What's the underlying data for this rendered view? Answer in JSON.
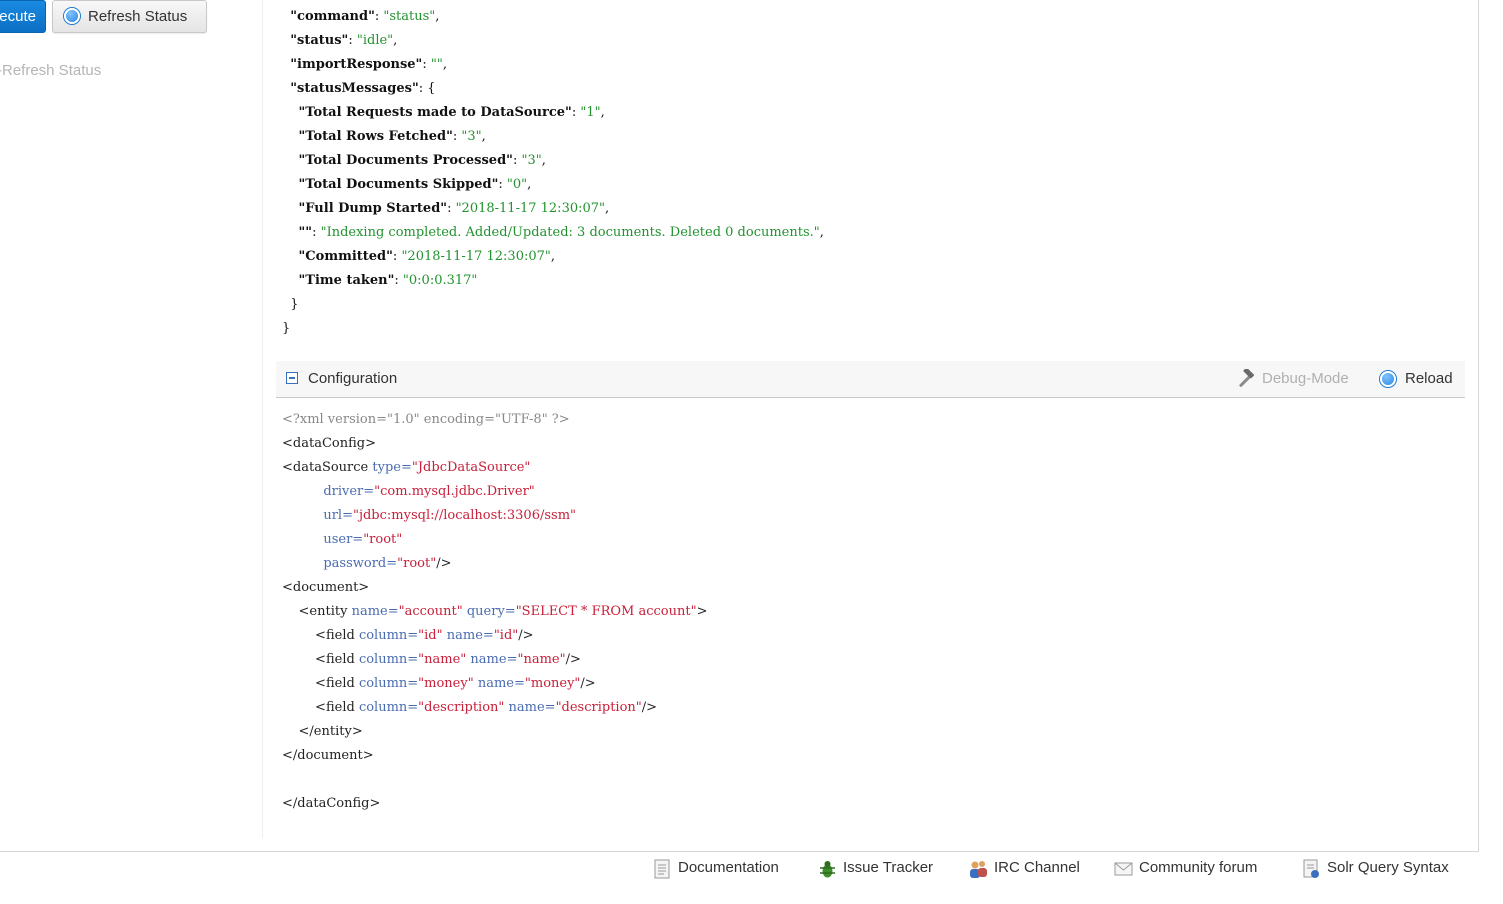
{
  "toolbar": {
    "execute_label": "ecute",
    "refresh_label": "Refresh Status",
    "auto_refresh_label": "-Refresh Status"
  },
  "status_json": {
    "lines": [
      [
        {
          "t": "  ",
          "c": "p"
        },
        {
          "t": "\"command\"",
          "c": "k"
        },
        {
          "t": ": ",
          "c": "p"
        },
        {
          "t": "\"status\"",
          "c": "s"
        },
        {
          "t": ",",
          "c": "p"
        }
      ],
      [
        {
          "t": "  ",
          "c": "p"
        },
        {
          "t": "\"status\"",
          "c": "k"
        },
        {
          "t": ": ",
          "c": "p"
        },
        {
          "t": "\"idle\"",
          "c": "s"
        },
        {
          "t": ",",
          "c": "p"
        }
      ],
      [
        {
          "t": "  ",
          "c": "p"
        },
        {
          "t": "\"importResponse\"",
          "c": "k"
        },
        {
          "t": ": ",
          "c": "p"
        },
        {
          "t": "\"\"",
          "c": "s"
        },
        {
          "t": ",",
          "c": "p"
        }
      ],
      [
        {
          "t": "  ",
          "c": "p"
        },
        {
          "t": "\"statusMessages\"",
          "c": "k"
        },
        {
          "t": ": {",
          "c": "p"
        }
      ],
      [
        {
          "t": "    ",
          "c": "p"
        },
        {
          "t": "\"Total Requests made to DataSource\"",
          "c": "k"
        },
        {
          "t": ": ",
          "c": "p"
        },
        {
          "t": "\"1\"",
          "c": "s"
        },
        {
          "t": ",",
          "c": "p"
        }
      ],
      [
        {
          "t": "    ",
          "c": "p"
        },
        {
          "t": "\"Total Rows Fetched\"",
          "c": "k"
        },
        {
          "t": ": ",
          "c": "p"
        },
        {
          "t": "\"3\"",
          "c": "s"
        },
        {
          "t": ",",
          "c": "p"
        }
      ],
      [
        {
          "t": "    ",
          "c": "p"
        },
        {
          "t": "\"Total Documents Processed\"",
          "c": "k"
        },
        {
          "t": ": ",
          "c": "p"
        },
        {
          "t": "\"3\"",
          "c": "s"
        },
        {
          "t": ",",
          "c": "p"
        }
      ],
      [
        {
          "t": "    ",
          "c": "p"
        },
        {
          "t": "\"Total Documents Skipped\"",
          "c": "k"
        },
        {
          "t": ": ",
          "c": "p"
        },
        {
          "t": "\"0\"",
          "c": "s"
        },
        {
          "t": ",",
          "c": "p"
        }
      ],
      [
        {
          "t": "    ",
          "c": "p"
        },
        {
          "t": "\"Full Dump Started\"",
          "c": "k"
        },
        {
          "t": ": ",
          "c": "p"
        },
        {
          "t": "\"2018-11-17 12:30:07\"",
          "c": "s"
        },
        {
          "t": ",",
          "c": "p"
        }
      ],
      [
        {
          "t": "    ",
          "c": "p"
        },
        {
          "t": "\"\"",
          "c": "k"
        },
        {
          "t": ": ",
          "c": "p"
        },
        {
          "t": "\"Indexing completed. Added/Updated: 3 documents. Deleted 0 documents.\"",
          "c": "s"
        },
        {
          "t": ",",
          "c": "p"
        }
      ],
      [
        {
          "t": "    ",
          "c": "p"
        },
        {
          "t": "\"Committed\"",
          "c": "k"
        },
        {
          "t": ": ",
          "c": "p"
        },
        {
          "t": "\"2018-11-17 12:30:07\"",
          "c": "s"
        },
        {
          "t": ",",
          "c": "p"
        }
      ],
      [
        {
          "t": "    ",
          "c": "p"
        },
        {
          "t": "\"Time taken\"",
          "c": "k"
        },
        {
          "t": ": ",
          "c": "p"
        },
        {
          "t": "\"0:0:0.317\"",
          "c": "s"
        }
      ],
      [
        {
          "t": "  }",
          "c": "p"
        }
      ],
      [
        {
          "t": "}",
          "c": "p"
        }
      ]
    ]
  },
  "config": {
    "title": "Configuration",
    "debug_label": "Debug-Mode",
    "reload_label": "Reload",
    "lines": [
      [
        {
          "t": "<?xml version=\"1.0\" encoding=\"UTF-8\" ?>",
          "c": "decl"
        }
      ],
      [
        {
          "t": "<dataConfig>",
          "c": "tag"
        }
      ],
      [
        {
          "t": "<dataSource ",
          "c": "tag"
        },
        {
          "t": "type=",
          "c": "attr"
        },
        {
          "t": "\"JdbcDataSource\"",
          "c": "val"
        }
      ],
      [
        {
          "t": "          ",
          "c": "p"
        },
        {
          "t": "driver=",
          "c": "attr"
        },
        {
          "t": "\"com.mysql.jdbc.Driver\"",
          "c": "val"
        }
      ],
      [
        {
          "t": "          ",
          "c": "p"
        },
        {
          "t": "url=",
          "c": "attr"
        },
        {
          "t": "\"jdbc:mysql://localhost:3306/ssm\"",
          "c": "val"
        }
      ],
      [
        {
          "t": "          ",
          "c": "p"
        },
        {
          "t": "user=",
          "c": "attr"
        },
        {
          "t": "\"root\"",
          "c": "val"
        }
      ],
      [
        {
          "t": "          ",
          "c": "p"
        },
        {
          "t": "password=",
          "c": "attr"
        },
        {
          "t": "\"root\"",
          "c": "val"
        },
        {
          "t": "/>",
          "c": "tag"
        }
      ],
      [
        {
          "t": "<document>",
          "c": "tag"
        }
      ],
      [
        {
          "t": "    <entity ",
          "c": "tag"
        },
        {
          "t": "name=",
          "c": "attr"
        },
        {
          "t": "\"account\"",
          "c": "val"
        },
        {
          "t": " ",
          "c": "p"
        },
        {
          "t": "query=",
          "c": "attr"
        },
        {
          "t": "\"SELECT * FROM account\"",
          "c": "val"
        },
        {
          "t": ">",
          "c": "tag"
        }
      ],
      [
        {
          "t": "        <field ",
          "c": "tag"
        },
        {
          "t": "column=",
          "c": "attr"
        },
        {
          "t": "\"id\"",
          "c": "val"
        },
        {
          "t": " ",
          "c": "p"
        },
        {
          "t": "name=",
          "c": "attr"
        },
        {
          "t": "\"id\"",
          "c": "val"
        },
        {
          "t": "/>",
          "c": "tag"
        }
      ],
      [
        {
          "t": "        <field ",
          "c": "tag"
        },
        {
          "t": "column=",
          "c": "attr"
        },
        {
          "t": "\"name\"",
          "c": "val"
        },
        {
          "t": " ",
          "c": "p"
        },
        {
          "t": "name=",
          "c": "attr"
        },
        {
          "t": "\"name\"",
          "c": "val"
        },
        {
          "t": "/>",
          "c": "tag"
        }
      ],
      [
        {
          "t": "        <field ",
          "c": "tag"
        },
        {
          "t": "column=",
          "c": "attr"
        },
        {
          "t": "\"money\"",
          "c": "val"
        },
        {
          "t": " ",
          "c": "p"
        },
        {
          "t": "name=",
          "c": "attr"
        },
        {
          "t": "\"money\"",
          "c": "val"
        },
        {
          "t": "/>",
          "c": "tag"
        }
      ],
      [
        {
          "t": "        <field ",
          "c": "tag"
        },
        {
          "t": "column=",
          "c": "attr"
        },
        {
          "t": "\"description\"",
          "c": "val"
        },
        {
          "t": " ",
          "c": "p"
        },
        {
          "t": "name=",
          "c": "attr"
        },
        {
          "t": "\"description\"",
          "c": "val"
        },
        {
          "t": "/>",
          "c": "tag"
        }
      ],
      [
        {
          "t": "    </entity>",
          "c": "tag"
        }
      ],
      [
        {
          "t": "</document>",
          "c": "tag"
        }
      ],
      [
        {
          "t": "",
          "c": "p"
        }
      ],
      [
        {
          "t": "</dataConfig>",
          "c": "tag"
        }
      ]
    ]
  },
  "footer": {
    "documentation": "Documentation",
    "issue_tracker": "Issue Tracker",
    "irc_channel": "IRC Channel",
    "community_forum": "Community forum",
    "solr_query_syntax": "Solr Query Syntax"
  }
}
